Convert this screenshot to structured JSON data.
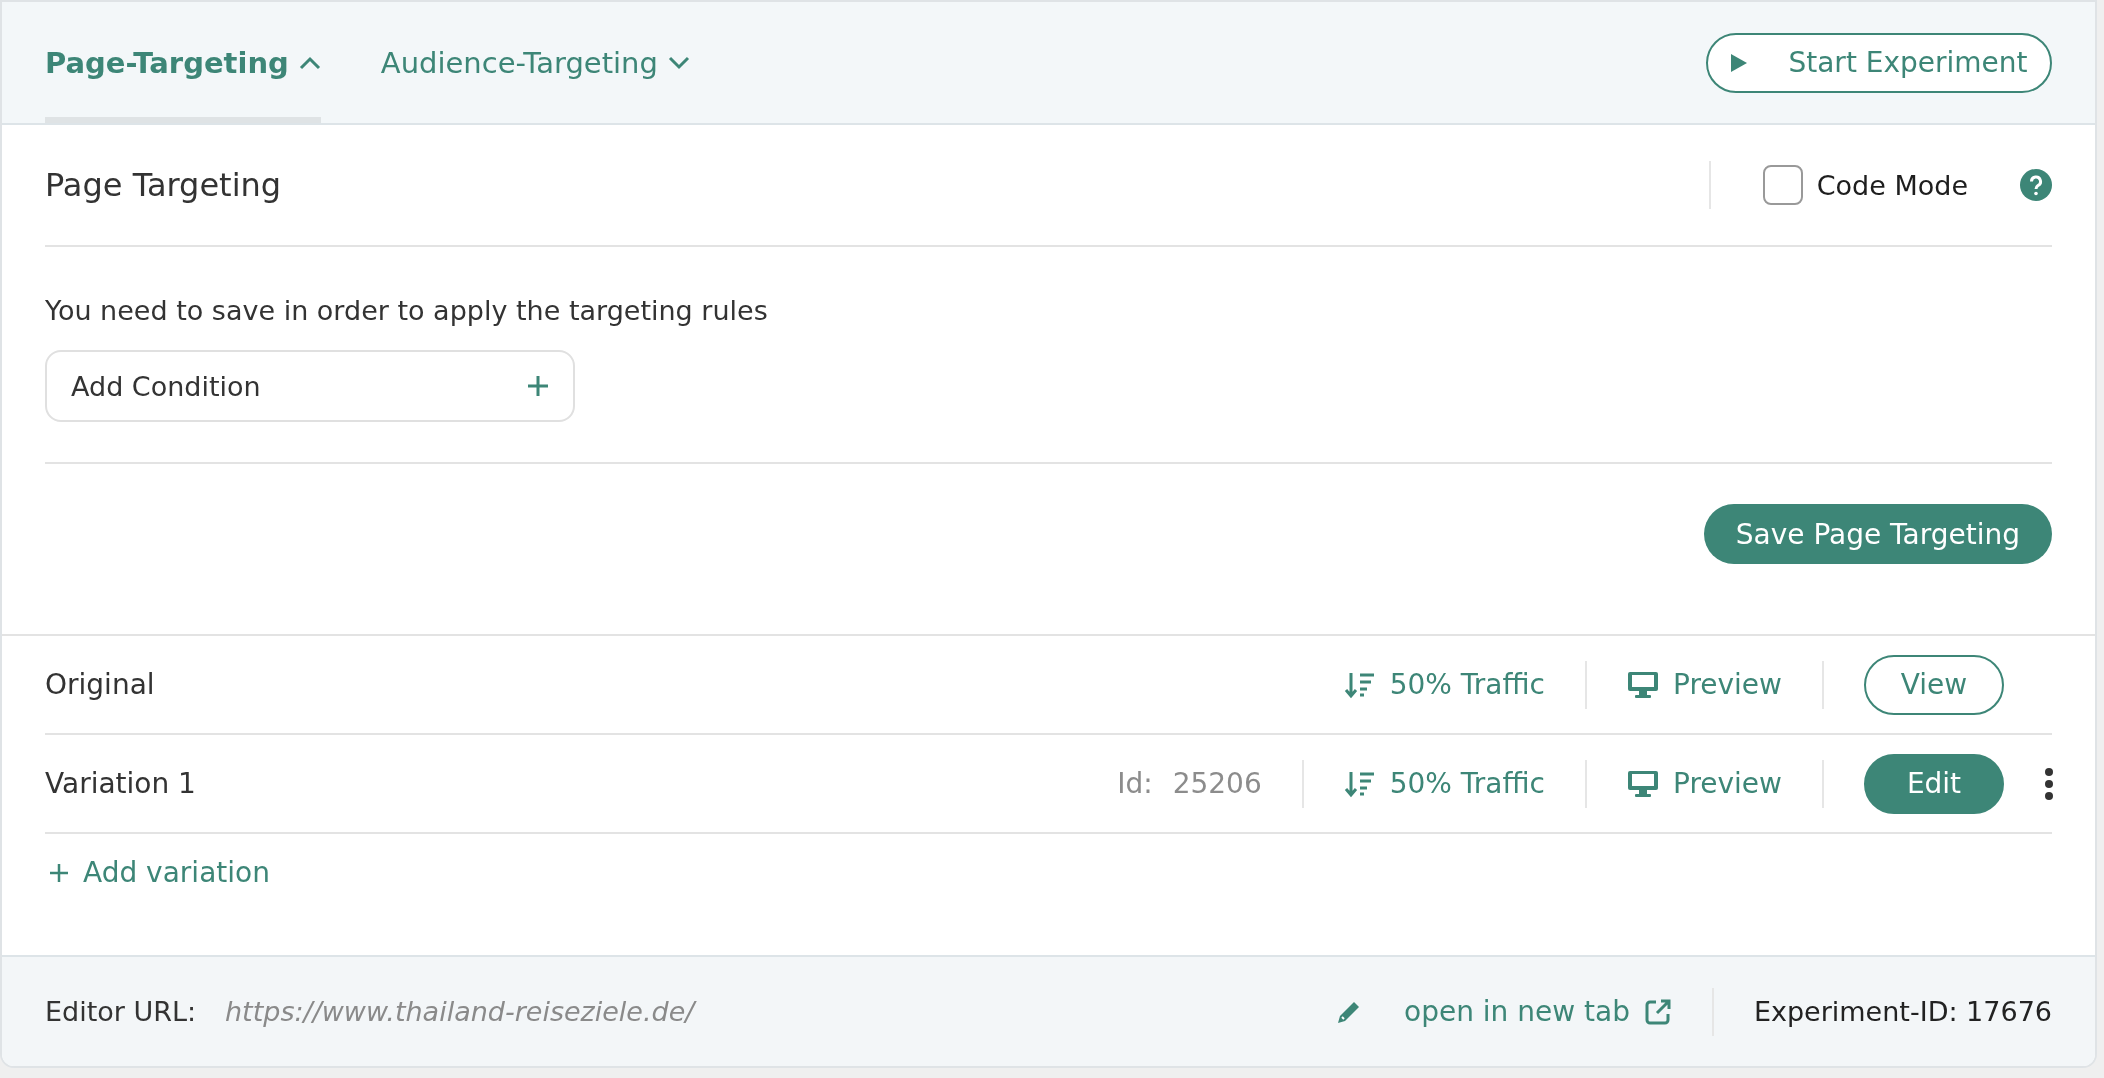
{
  "tabs": [
    {
      "label": "Page-Targeting",
      "selected": true,
      "expanded": true
    },
    {
      "label": "Audience-Targeting",
      "selected": false,
      "expanded": false
    }
  ],
  "start_button": "Start Experiment",
  "page_targeting": {
    "title": "Page Targeting",
    "code_mode": {
      "label": "Code Mode",
      "checked": false
    },
    "message": "You need to save in order to apply the targeting rules",
    "add_condition": "Add Condition",
    "save_button": "Save Page Targeting"
  },
  "variations": [
    {
      "name": "Original",
      "traffic": "50% Traffic",
      "preview": "Preview",
      "action": "View",
      "kind": "original"
    },
    {
      "name": "Variation 1",
      "id_label": "Id:",
      "id": "25206",
      "traffic": "50% Traffic",
      "preview": "Preview",
      "action": "Edit",
      "kind": "variation"
    }
  ],
  "add_variation": "Add variation",
  "footer": {
    "label": "Editor URL:",
    "url": "https://www.thailand-reiseziele.de/",
    "open_link": "open in new tab",
    "experiment_id": "Experiment-ID: 17676"
  }
}
